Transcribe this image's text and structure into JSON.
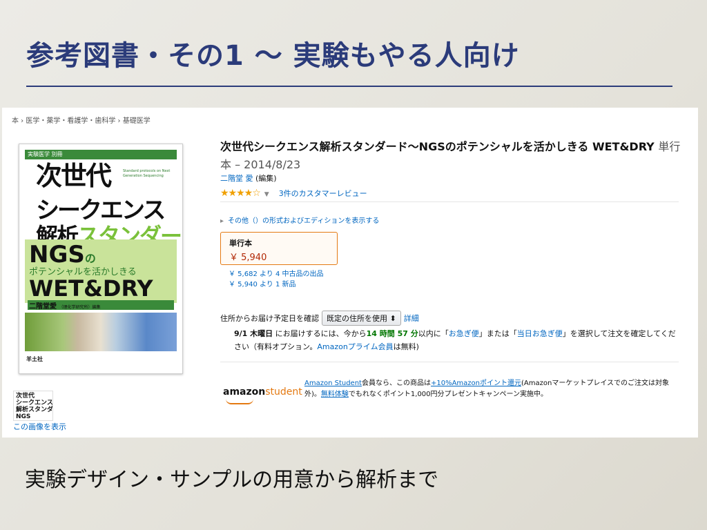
{
  "slide": {
    "title": "参考図書・その1 〜 実験もやる人向け",
    "caption": "実験デザイン・サンプルの用意から解析まで"
  },
  "amazon": {
    "breadcrumb": "本 › 医学・薬学・看護学・歯科学 › 基礎医学",
    "cover": {
      "series": "実験医学 別冊",
      "title_line1": "次世代",
      "title_line2": "シークエンス",
      "title_line3a": "解析",
      "title_line3b": "スタンダード",
      "english": "Standard protocols on Next Generation Sequencing",
      "ngs": "NGS",
      "ngs_no": "の",
      "potential": "ポテンシャルを活かしきる",
      "wetdry": "WET&DRY",
      "author": "二階堂愛",
      "editor_suffix": "（理化学研究所）編集",
      "publisher": "羊土社"
    },
    "thumbnail": {
      "line1": "次世代",
      "line2": "シークエンス",
      "line3": "解析スタンダード",
      "line4": "NGS"
    },
    "view_image_link": "この画像を表示",
    "product_title": "次世代シークエンス解析スタンダード〜NGSのポテンシャルを活かしきる WET&DRY",
    "format_date": "単行本 – 2014/8/23",
    "author_name": "二階堂 愛",
    "author_role": "(編集)",
    "rating": {
      "stars_display": "★★★★☆",
      "value": 3.5,
      "reviews_link": "3件のカスタマーレビュー"
    },
    "other_editions": "その他（）の形式およびエディションを表示する",
    "format_box": {
      "label": "単行本",
      "price": "￥ 5,940"
    },
    "offers": {
      "used": "￥ 5,682 より 4 中古品の出品",
      "new": "￥ 5,940 より 1 新品"
    },
    "delivery": {
      "label": "住所からお届け予定日を確認",
      "select_value": "既定の住所を使用",
      "details_link": "詳細"
    },
    "shipping": {
      "date": "9/1 木曜日",
      "text1": "にお届けするには、今から",
      "countdown": "14 時間 57 分",
      "text2": "以内に「",
      "express": "お急ぎ便",
      "text3": "」または「",
      "sameday": "当日お急ぎ便",
      "text4": "」を選択して注文を確定してください（有料オプション。",
      "prime": "Amazonプライム会員",
      "text5": "は無料)"
    },
    "student": {
      "logo_amazon": "amazon",
      "logo_student": "student",
      "link1": "Amazon Student",
      "text1": "会員なら、この商品は",
      "link2": "+10%Amazonポイント還元",
      "text2": "(Amazonマーケットプレイスでのご注文は対象外)。",
      "link3": "無料体験",
      "text3": "でもれなくポイント1,000円分プレゼントキャンペーン実施中。"
    }
  }
}
